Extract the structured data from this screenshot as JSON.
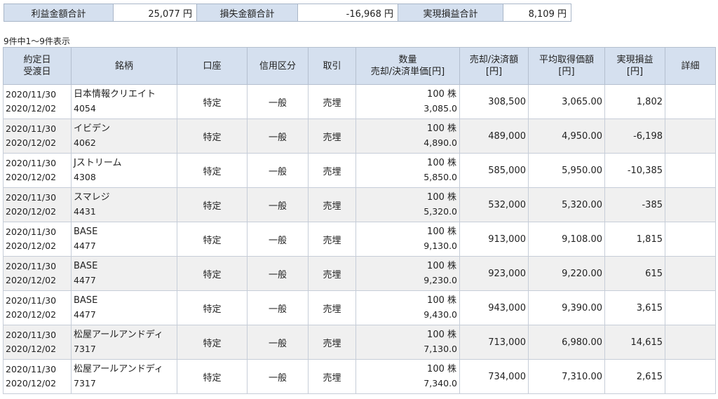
{
  "summary": {
    "profit_label": "利益金額合計",
    "profit_value": "25,077",
    "profit_unit": "円",
    "loss_label": "損失金額合計",
    "loss_value": "-16,968",
    "loss_unit": "円",
    "realized_label": "実現損益合計",
    "realized_value": "8,109",
    "realized_unit": "円"
  },
  "count_text": "9件中1〜9件表示",
  "table": {
    "headers": {
      "date_1": "約定日",
      "date_2": "受渡日",
      "name": "銘柄",
      "account": "口座",
      "credit": "信用区分",
      "trade": "取引",
      "qty_1": "数量",
      "qty_2": "売却/決済単価[円]",
      "sell_1": "売却/決済額",
      "sell_2": "[円]",
      "avg_1": "平均取得価額",
      "avg_2": "[円]",
      "pl_1": "実現損益",
      "pl_2": "[円]",
      "detail": "詳細"
    },
    "rows": [
      {
        "trade_date": "2020/11/30",
        "settle_date": "2020/12/02",
        "name": "日本情報クリエイト",
        "code": "4054",
        "account": "特定",
        "credit": "一般",
        "trade": "売埋",
        "qty": "100 株",
        "price": "3,085.0",
        "sell_amount": "308,500",
        "avg_cost": "3,065.00",
        "pl": "1,802"
      },
      {
        "trade_date": "2020/11/30",
        "settle_date": "2020/12/02",
        "name": "イビデン",
        "code": "4062",
        "account": "特定",
        "credit": "一般",
        "trade": "売埋",
        "qty": "100 株",
        "price": "4,890.0",
        "sell_amount": "489,000",
        "avg_cost": "4,950.00",
        "pl": "-6,198"
      },
      {
        "trade_date": "2020/11/30",
        "settle_date": "2020/12/02",
        "name": "Jストリーム",
        "code": "4308",
        "account": "特定",
        "credit": "一般",
        "trade": "売埋",
        "qty": "100 株",
        "price": "5,850.0",
        "sell_amount": "585,000",
        "avg_cost": "5,950.00",
        "pl": "-10,385"
      },
      {
        "trade_date": "2020/11/30",
        "settle_date": "2020/12/02",
        "name": "スマレジ",
        "code": "4431",
        "account": "特定",
        "credit": "一般",
        "trade": "売埋",
        "qty": "100 株",
        "price": "5,320.0",
        "sell_amount": "532,000",
        "avg_cost": "5,320.00",
        "pl": "-385"
      },
      {
        "trade_date": "2020/11/30",
        "settle_date": "2020/12/02",
        "name": "BASE",
        "code": "4477",
        "account": "特定",
        "credit": "一般",
        "trade": "売埋",
        "qty": "100 株",
        "price": "9,130.0",
        "sell_amount": "913,000",
        "avg_cost": "9,108.00",
        "pl": "1,815"
      },
      {
        "trade_date": "2020/11/30",
        "settle_date": "2020/12/02",
        "name": "BASE",
        "code": "4477",
        "account": "特定",
        "credit": "一般",
        "trade": "売埋",
        "qty": "100 株",
        "price": "9,230.0",
        "sell_amount": "923,000",
        "avg_cost": "9,220.00",
        "pl": "615"
      },
      {
        "trade_date": "2020/11/30",
        "settle_date": "2020/12/02",
        "name": "BASE",
        "code": "4477",
        "account": "特定",
        "credit": "一般",
        "trade": "売埋",
        "qty": "100 株",
        "price": "9,430.0",
        "sell_amount": "943,000",
        "avg_cost": "9,390.00",
        "pl": "3,615"
      },
      {
        "trade_date": "2020/11/30",
        "settle_date": "2020/12/02",
        "name": "松屋アールアンドディ",
        "code": "7317",
        "account": "特定",
        "credit": "一般",
        "trade": "売埋",
        "qty": "100 株",
        "price": "7,130.0",
        "sell_amount": "713,000",
        "avg_cost": "6,980.00",
        "pl": "14,615"
      },
      {
        "trade_date": "2020/11/30",
        "settle_date": "2020/12/02",
        "name": "松屋アールアンドディ",
        "code": "7317",
        "account": "特定",
        "credit": "一般",
        "trade": "売埋",
        "qty": "100 株",
        "price": "7,340.0",
        "sell_amount": "734,000",
        "avg_cost": "7,310.00",
        "pl": "2,615"
      }
    ]
  }
}
